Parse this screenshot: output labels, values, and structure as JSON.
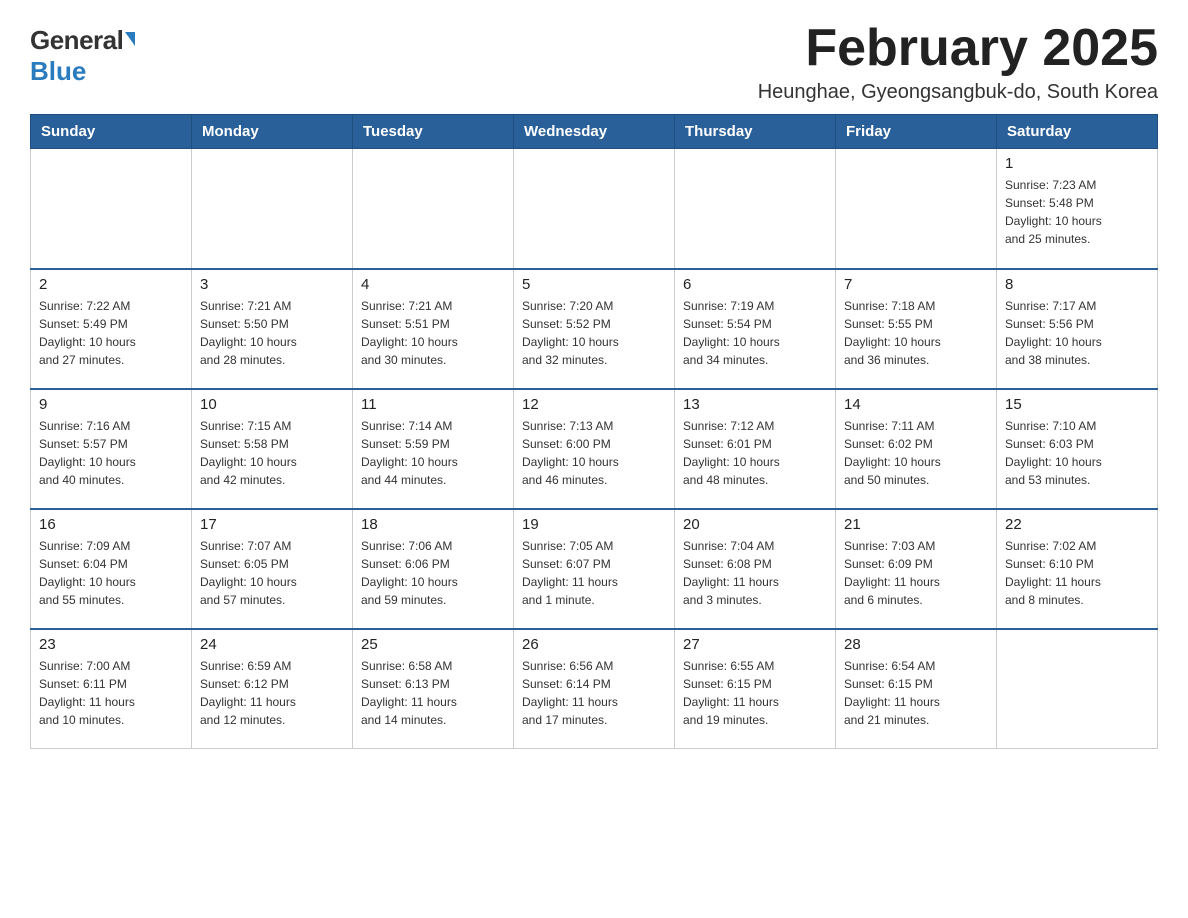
{
  "logo": {
    "general": "General",
    "blue": "Blue"
  },
  "header": {
    "month": "February 2025",
    "location": "Heunghae, Gyeongsangbuk-do, South Korea"
  },
  "days_of_week": [
    "Sunday",
    "Monday",
    "Tuesday",
    "Wednesday",
    "Thursday",
    "Friday",
    "Saturday"
  ],
  "weeks": [
    {
      "days": [
        {
          "number": "",
          "info": ""
        },
        {
          "number": "",
          "info": ""
        },
        {
          "number": "",
          "info": ""
        },
        {
          "number": "",
          "info": ""
        },
        {
          "number": "",
          "info": ""
        },
        {
          "number": "",
          "info": ""
        },
        {
          "number": "1",
          "info": "Sunrise: 7:23 AM\nSunset: 5:48 PM\nDaylight: 10 hours\nand 25 minutes."
        }
      ]
    },
    {
      "days": [
        {
          "number": "2",
          "info": "Sunrise: 7:22 AM\nSunset: 5:49 PM\nDaylight: 10 hours\nand 27 minutes."
        },
        {
          "number": "3",
          "info": "Sunrise: 7:21 AM\nSunset: 5:50 PM\nDaylight: 10 hours\nand 28 minutes."
        },
        {
          "number": "4",
          "info": "Sunrise: 7:21 AM\nSunset: 5:51 PM\nDaylight: 10 hours\nand 30 minutes."
        },
        {
          "number": "5",
          "info": "Sunrise: 7:20 AM\nSunset: 5:52 PM\nDaylight: 10 hours\nand 32 minutes."
        },
        {
          "number": "6",
          "info": "Sunrise: 7:19 AM\nSunset: 5:54 PM\nDaylight: 10 hours\nand 34 minutes."
        },
        {
          "number": "7",
          "info": "Sunrise: 7:18 AM\nSunset: 5:55 PM\nDaylight: 10 hours\nand 36 minutes."
        },
        {
          "number": "8",
          "info": "Sunrise: 7:17 AM\nSunset: 5:56 PM\nDaylight: 10 hours\nand 38 minutes."
        }
      ]
    },
    {
      "days": [
        {
          "number": "9",
          "info": "Sunrise: 7:16 AM\nSunset: 5:57 PM\nDaylight: 10 hours\nand 40 minutes."
        },
        {
          "number": "10",
          "info": "Sunrise: 7:15 AM\nSunset: 5:58 PM\nDaylight: 10 hours\nand 42 minutes."
        },
        {
          "number": "11",
          "info": "Sunrise: 7:14 AM\nSunset: 5:59 PM\nDaylight: 10 hours\nand 44 minutes."
        },
        {
          "number": "12",
          "info": "Sunrise: 7:13 AM\nSunset: 6:00 PM\nDaylight: 10 hours\nand 46 minutes."
        },
        {
          "number": "13",
          "info": "Sunrise: 7:12 AM\nSunset: 6:01 PM\nDaylight: 10 hours\nand 48 minutes."
        },
        {
          "number": "14",
          "info": "Sunrise: 7:11 AM\nSunset: 6:02 PM\nDaylight: 10 hours\nand 50 minutes."
        },
        {
          "number": "15",
          "info": "Sunrise: 7:10 AM\nSunset: 6:03 PM\nDaylight: 10 hours\nand 53 minutes."
        }
      ]
    },
    {
      "days": [
        {
          "number": "16",
          "info": "Sunrise: 7:09 AM\nSunset: 6:04 PM\nDaylight: 10 hours\nand 55 minutes."
        },
        {
          "number": "17",
          "info": "Sunrise: 7:07 AM\nSunset: 6:05 PM\nDaylight: 10 hours\nand 57 minutes."
        },
        {
          "number": "18",
          "info": "Sunrise: 7:06 AM\nSunset: 6:06 PM\nDaylight: 10 hours\nand 59 minutes."
        },
        {
          "number": "19",
          "info": "Sunrise: 7:05 AM\nSunset: 6:07 PM\nDaylight: 11 hours\nand 1 minute."
        },
        {
          "number": "20",
          "info": "Sunrise: 7:04 AM\nSunset: 6:08 PM\nDaylight: 11 hours\nand 3 minutes."
        },
        {
          "number": "21",
          "info": "Sunrise: 7:03 AM\nSunset: 6:09 PM\nDaylight: 11 hours\nand 6 minutes."
        },
        {
          "number": "22",
          "info": "Sunrise: 7:02 AM\nSunset: 6:10 PM\nDaylight: 11 hours\nand 8 minutes."
        }
      ]
    },
    {
      "days": [
        {
          "number": "23",
          "info": "Sunrise: 7:00 AM\nSunset: 6:11 PM\nDaylight: 11 hours\nand 10 minutes."
        },
        {
          "number": "24",
          "info": "Sunrise: 6:59 AM\nSunset: 6:12 PM\nDaylight: 11 hours\nand 12 minutes."
        },
        {
          "number": "25",
          "info": "Sunrise: 6:58 AM\nSunset: 6:13 PM\nDaylight: 11 hours\nand 14 minutes."
        },
        {
          "number": "26",
          "info": "Sunrise: 6:56 AM\nSunset: 6:14 PM\nDaylight: 11 hours\nand 17 minutes."
        },
        {
          "number": "27",
          "info": "Sunrise: 6:55 AM\nSunset: 6:15 PM\nDaylight: 11 hours\nand 19 minutes."
        },
        {
          "number": "28",
          "info": "Sunrise: 6:54 AM\nSunset: 6:15 PM\nDaylight: 11 hours\nand 21 minutes."
        },
        {
          "number": "",
          "info": ""
        }
      ]
    }
  ]
}
